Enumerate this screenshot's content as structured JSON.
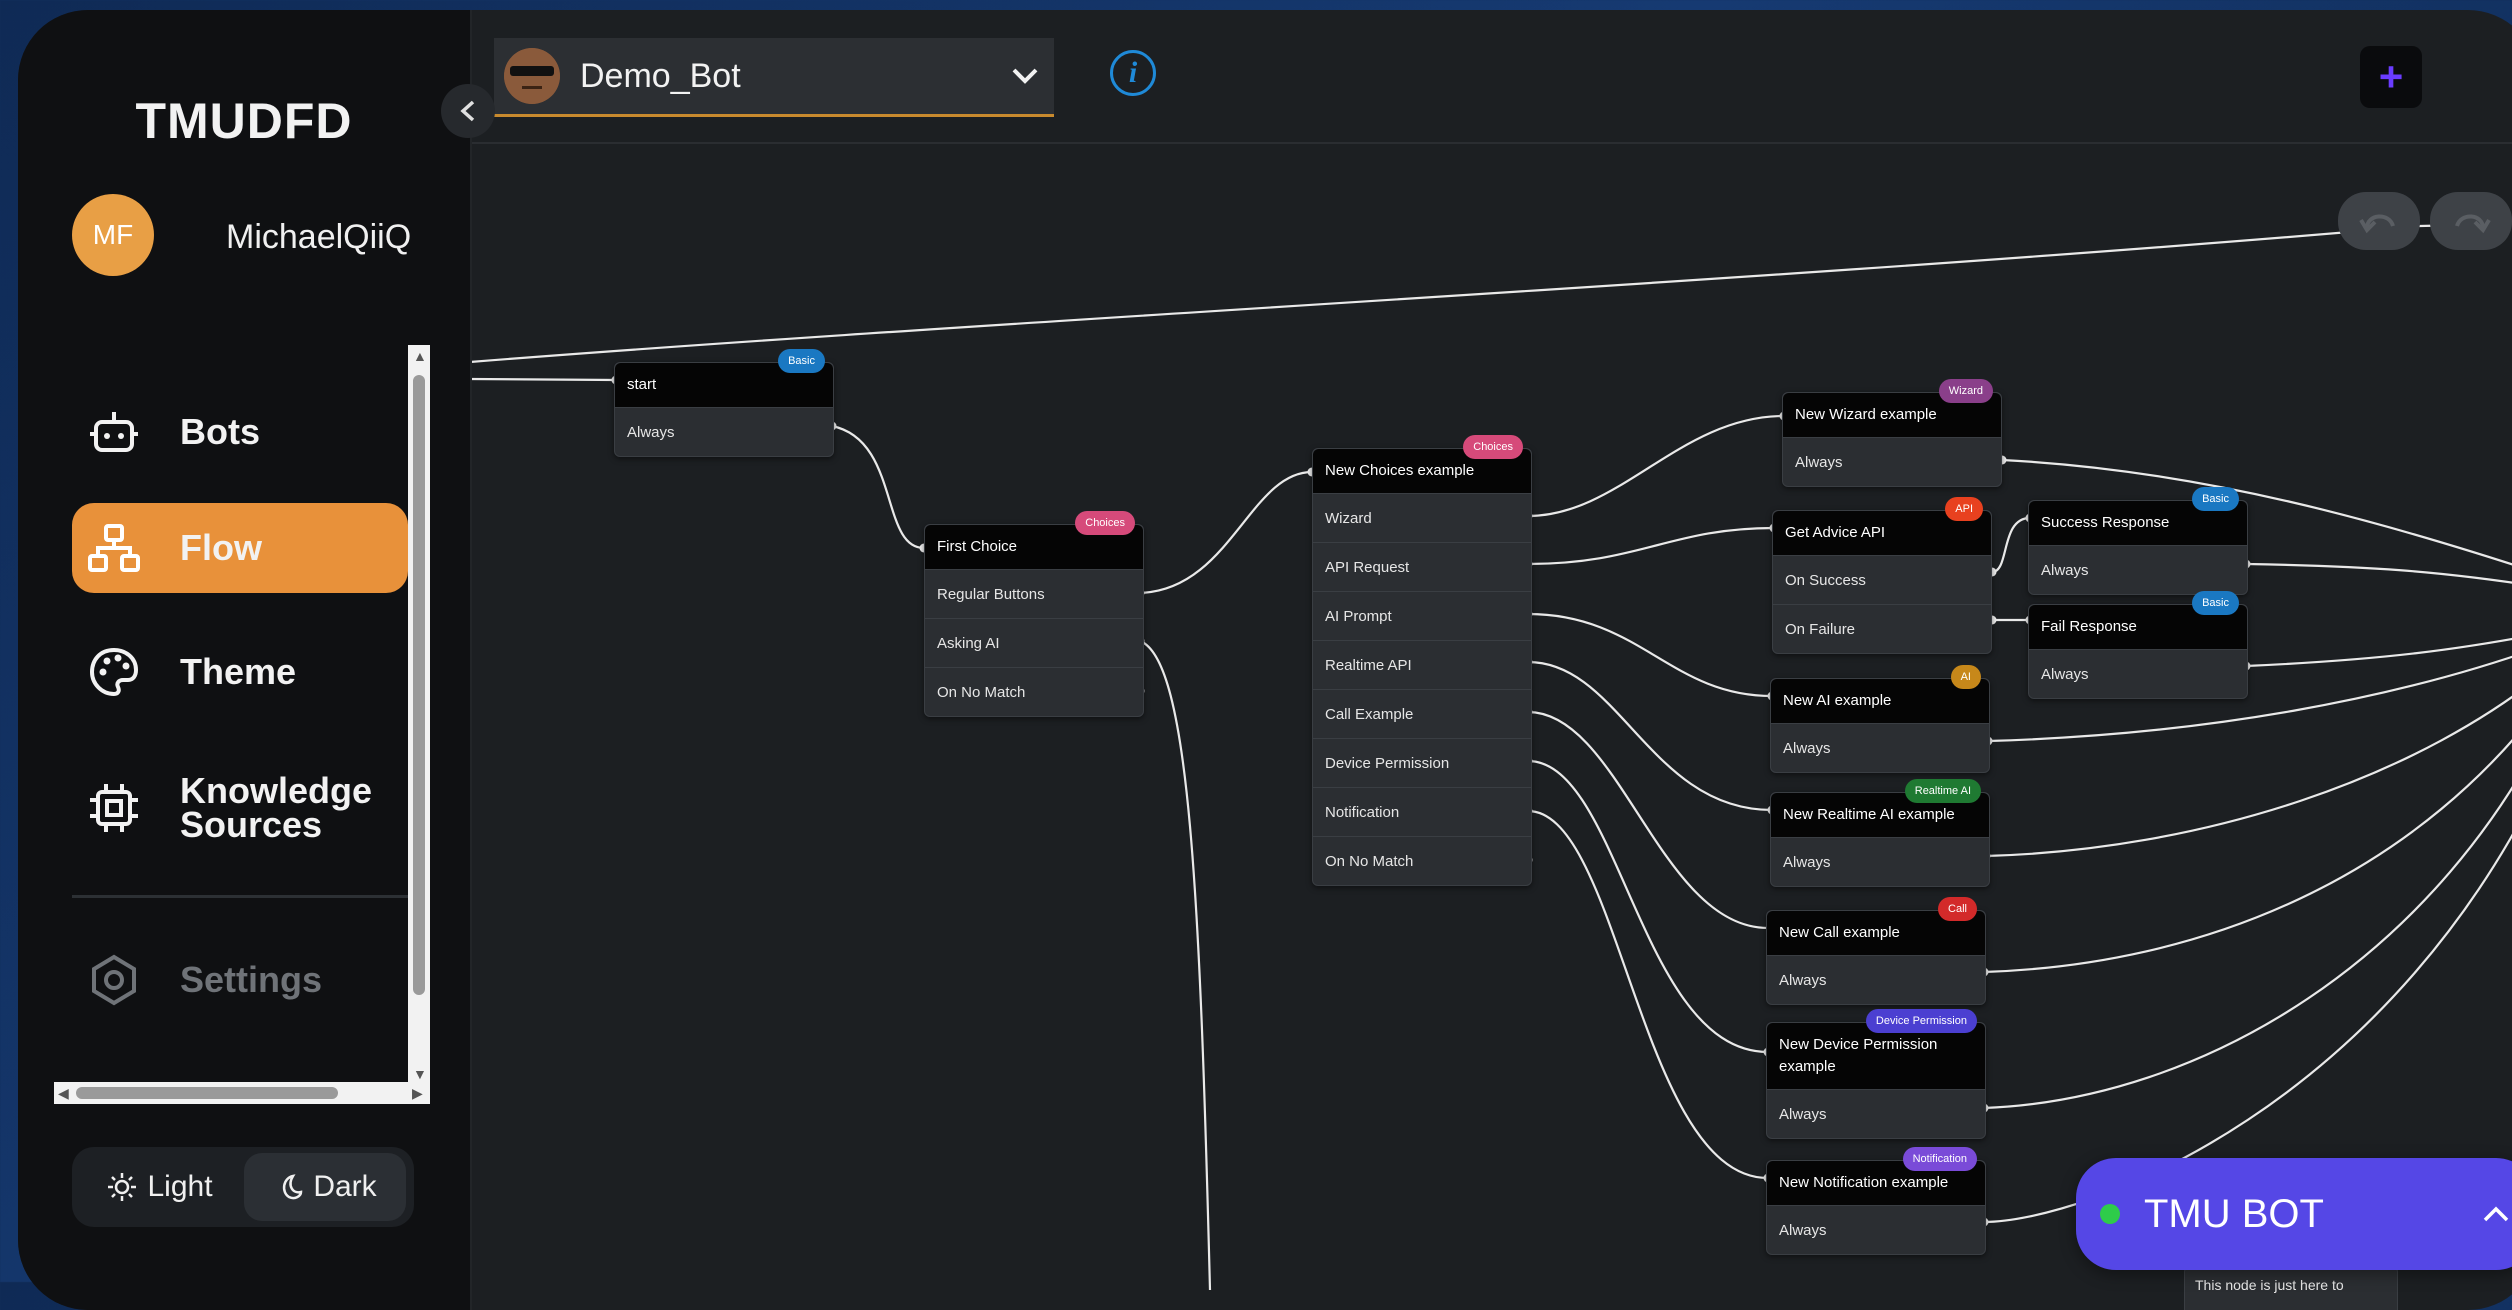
{
  "sidebar": {
    "brand": "TMUDFD",
    "user": {
      "initials": "MF",
      "name": "MichaelQiiQ",
      "avatar_color": "#e89f45"
    },
    "nav": [
      {
        "label": "Bots",
        "icon": "robot-icon",
        "active": false
      },
      {
        "label": "Flow",
        "icon": "flow-icon",
        "active": true
      },
      {
        "label": "Theme",
        "icon": "palette-icon",
        "active": false
      },
      {
        "label": "Knowledge Sources",
        "icon": "chip-icon",
        "active": false
      },
      {
        "label": "Settings",
        "icon": "hexagon-icon",
        "active": false,
        "disabled": true
      }
    ],
    "theme_toggle": {
      "light": "Light",
      "dark": "Dark",
      "selected": "Dark"
    }
  },
  "topbar": {
    "bot_name": "Demo_Bot",
    "info_icon": "info-icon",
    "add_icon": "plus-icon"
  },
  "nodes": [
    {
      "title": "start",
      "badge": "Basic",
      "badge_color": "#1a78c2",
      "rows": [
        "Always"
      ]
    },
    {
      "title": "First Choice",
      "badge": "Choices",
      "badge_color": "#d64a7a",
      "rows": [
        "Regular Buttons",
        "Asking AI",
        "On No Match"
      ]
    },
    {
      "title": "New Choices example",
      "badge": "Choices",
      "badge_color": "#d64a7a",
      "rows": [
        "Wizard",
        "API Request",
        "AI Prompt",
        "Realtime API",
        "Call Example",
        "Device Permission",
        "Notification",
        "On No Match"
      ]
    },
    {
      "title": "New Wizard example",
      "badge": "Wizard",
      "badge_color": "#8a3f8a",
      "rows": [
        "Always"
      ]
    },
    {
      "title": "Get Advice API",
      "badge": "API",
      "badge_color": "#e8411f",
      "rows": [
        "On Success",
        "On Failure"
      ]
    },
    {
      "title": "Success Response",
      "badge": "Basic",
      "badge_color": "#1a78c2",
      "rows": [
        "Always"
      ]
    },
    {
      "title": "Fail Response",
      "badge": "Basic",
      "badge_color": "#1a78c2",
      "rows": [
        "Always"
      ]
    },
    {
      "title": "New AI example",
      "badge": "AI",
      "badge_color": "#c7881a",
      "rows": [
        "Always"
      ]
    },
    {
      "title": "New Realtime AI example",
      "badge": "Realtime AI",
      "badge_color": "#1f7a32",
      "rows": [
        "Always"
      ]
    },
    {
      "title": "New Call example",
      "badge": "Call",
      "badge_color": "#d32a2a",
      "rows": [
        "Always"
      ]
    },
    {
      "title": "New Device Permission example",
      "badge": "Device Permission",
      "badge_color": "#4b3fd1",
      "rows": [
        "Always"
      ]
    },
    {
      "title": "New Notification example",
      "badge": "Notification",
      "badge_color": "#7a4bd8",
      "rows": [
        "Always"
      ]
    }
  ],
  "chat_widget": {
    "title": "TMU BOT",
    "status_color": "#2ecc4a"
  },
  "partial_node_text": "This node is just here to"
}
